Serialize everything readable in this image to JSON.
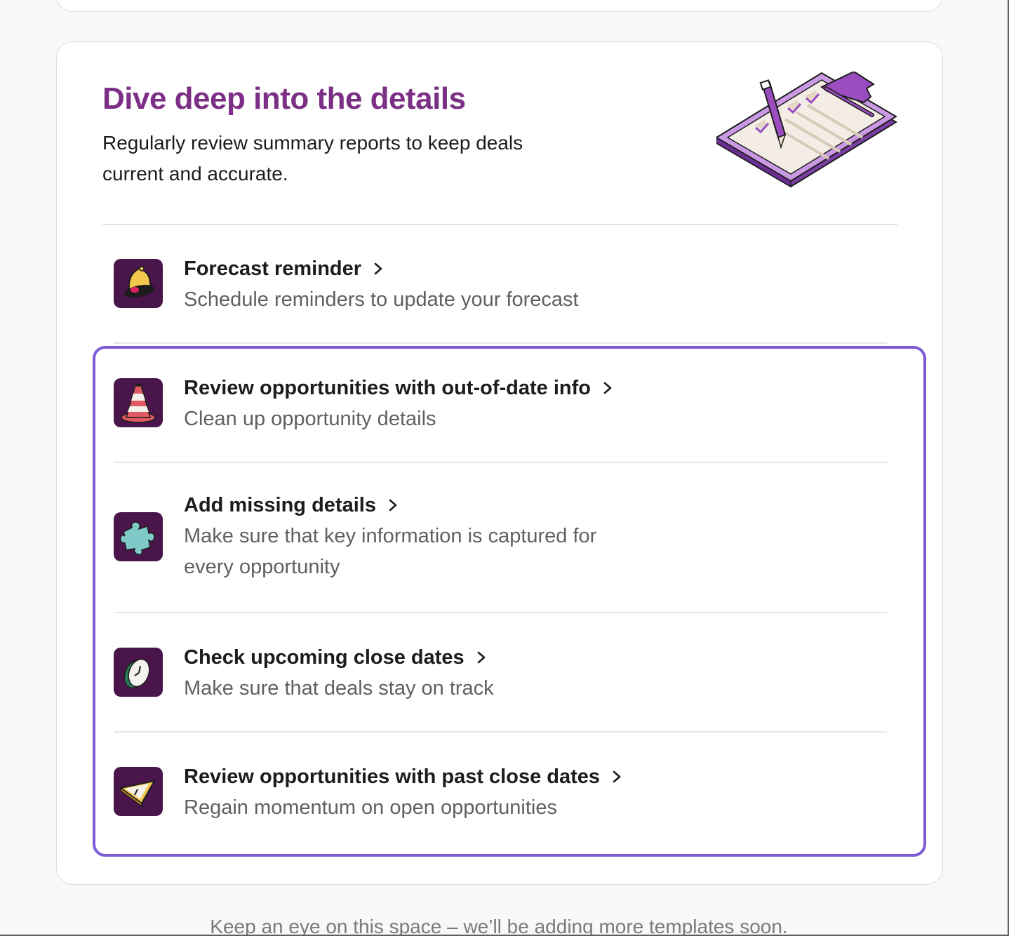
{
  "section": {
    "title": "Dive deep into the details",
    "subtitle": "Regularly review summary reports to keep deals current and accurate.",
    "illustration": "clipboard-checklist-illustration"
  },
  "templates": [
    {
      "title": "Forecast reminder",
      "description": "Schedule reminders to update your forecast",
      "icon": "bell-icon"
    },
    {
      "title": "Review opportunities with out-of-date info",
      "description": "Clean up opportunity details",
      "icon": "traffic-cone-icon"
    },
    {
      "title": "Add missing details",
      "description": "Make sure that key information is captured for every opportunity",
      "icon": "puzzle-piece-icon"
    },
    {
      "title": "Check upcoming close dates",
      "description": "Make sure that deals stay on track",
      "icon": "clock-icon"
    },
    {
      "title": "Review opportunities with past close dates",
      "description": "Regain momentum on open opportunities",
      "icon": "hourglass-icon"
    }
  ],
  "footer": {
    "note": "Keep an eye on this space – we’ll be adding more templates soon."
  },
  "colors": {
    "accent_title": "#7c3085",
    "icon_tile": "#4a154b",
    "focus_ring": "#7b5bd6",
    "description_text": "#616061"
  }
}
